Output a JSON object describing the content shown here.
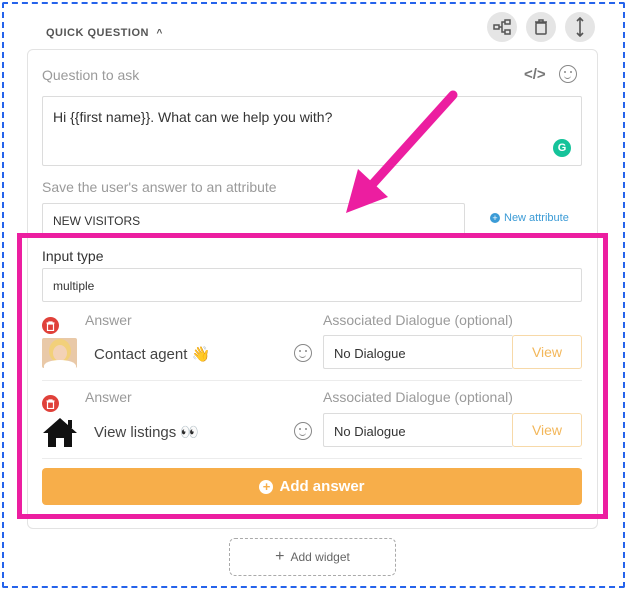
{
  "header": {
    "title": "QUICK QUESTION"
  },
  "question": {
    "label": "Question to ask",
    "value": "Hi {{first name}}. What can we help you with?"
  },
  "attribute": {
    "label": "Save the user's answer to an attribute",
    "value": "NEW VISITORS",
    "new_attribute_label": "New attribute"
  },
  "input_type": {
    "label": "Input type",
    "value": "multiple"
  },
  "answers": [
    {
      "answer_label": "Answer",
      "text": "Contact agent 👋",
      "dialogue_label": "Associated Dialogue (optional)",
      "dialogue_value": "No Dialogue",
      "view_label": "View",
      "avatar_icon": "person-photo-icon"
    },
    {
      "answer_label": "Answer",
      "text": "View listings 👀",
      "dialogue_label": "Associated Dialogue (optional)",
      "dialogue_value": "No Dialogue",
      "view_label": "View",
      "avatar_icon": "house-icon"
    }
  ],
  "add_answer_label": "Add answer",
  "add_widget_label": "Add widget",
  "colors": {
    "highlight": "#ec1ea0",
    "frame": "#2563eb",
    "accent": "#f7ae4a",
    "delete": "#e0413a",
    "link": "#3b9bd6"
  }
}
